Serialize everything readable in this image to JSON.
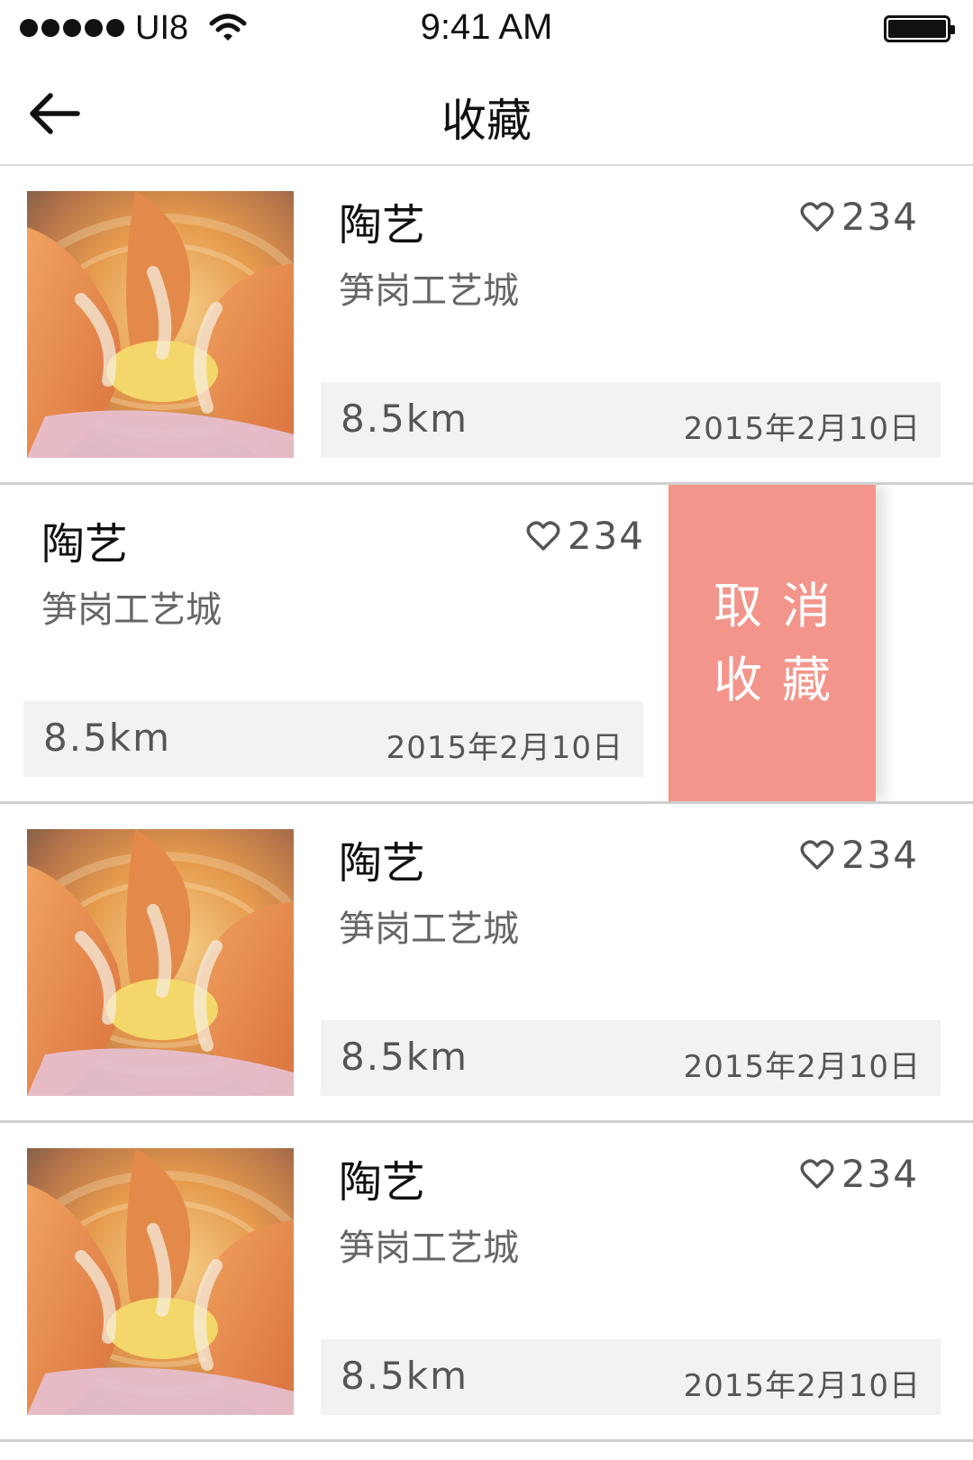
{
  "status_bar": {
    "carrier": "UI8",
    "time": "9:41 AM"
  },
  "header": {
    "title": "收藏"
  },
  "items": [
    {
      "title": "陶艺",
      "likes": "234",
      "subtitle": "笋岗工艺城",
      "distance": "8.5km",
      "date": "2015年2月10日"
    },
    {
      "title": "陶艺",
      "likes": "234",
      "subtitle": "笋岗工艺城",
      "distance": "8.5km",
      "date": "2015年2月10日",
      "swiped": true
    },
    {
      "title": "陶艺",
      "likes": "234",
      "subtitle": "笋岗工艺城",
      "distance": "8.5km",
      "date": "2015年2月10日"
    },
    {
      "title": "陶艺",
      "likes": "234",
      "subtitle": "笋岗工艺城",
      "distance": "8.5km",
      "date": "2015年2月10日"
    }
  ],
  "swipe_action": {
    "line1": "取消",
    "line2": "收藏",
    "color": "#f3958b"
  },
  "icons": {
    "back": "arrow-left-icon",
    "likes": "heart-outline-icon",
    "thumbnail": "pottery-hands-image"
  }
}
